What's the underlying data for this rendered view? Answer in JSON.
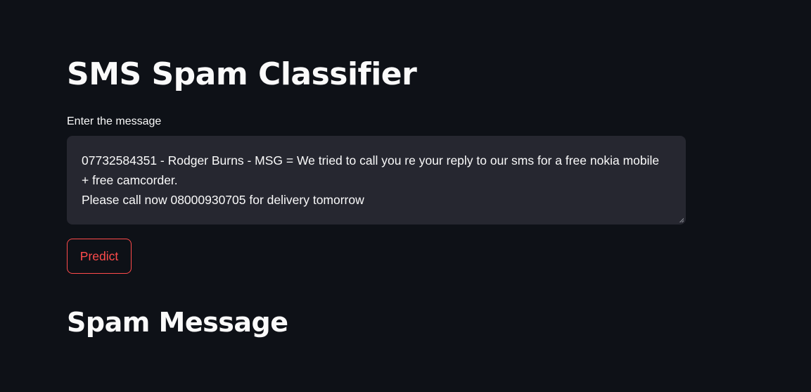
{
  "page": {
    "title": "SMS Spam Classifier"
  },
  "input": {
    "label": "Enter the message",
    "value": "07732584351 - Rodger Burns - MSG = We tried to call you re your reply to our sms for a free nokia mobile + free camcorder.\nPlease call now 08000930705 for delivery tomorrow"
  },
  "actions": {
    "predict_label": "Predict"
  },
  "result": {
    "text": "Spam Message"
  },
  "colors": {
    "background": "#0e1117",
    "input_background": "#262730",
    "accent": "#ff4b4b",
    "text": "#fafafa"
  }
}
